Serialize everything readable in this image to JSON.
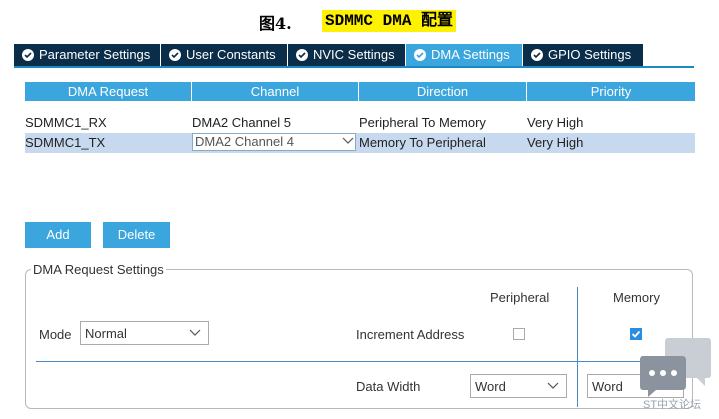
{
  "caption": {
    "number": "图4.",
    "title": "SDMMC DMA 配置"
  },
  "tabs": [
    {
      "label": "Parameter Settings",
      "active": false
    },
    {
      "label": "User Constants",
      "active": false
    },
    {
      "label": "NVIC Settings",
      "active": false
    },
    {
      "label": "DMA Settings",
      "active": true
    },
    {
      "label": "GPIO Settings",
      "active": false
    }
  ],
  "table": {
    "headers": [
      "DMA Request",
      "Channel",
      "Direction",
      "Priority"
    ],
    "rows": [
      {
        "request": "SDMMC1_RX",
        "channel": "DMA2 Channel 5",
        "direction": "Peripheral To Memory",
        "priority": "Very High",
        "selected": false
      },
      {
        "request": "SDMMC1_TX",
        "channel": "DMA2 Channel 4",
        "direction": "Memory To Peripheral",
        "priority": "Very High",
        "selected": true
      }
    ]
  },
  "buttons": {
    "add": "Add",
    "delete": "Delete"
  },
  "settings": {
    "legend": "DMA Request Settings",
    "mode_label": "Mode",
    "mode_value": "Normal",
    "col_peripheral": "Peripheral",
    "col_memory": "Memory",
    "increment_label": "Increment Address",
    "increment_peripheral": false,
    "increment_memory": true,
    "data_width_label": "Data Width",
    "data_width_peripheral": "Word",
    "data_width_memory": "Word"
  },
  "watermark": {
    "text": "ST中文论坛"
  },
  "colors": {
    "tab_dark": "#0a2d4a",
    "tab_active": "#3aa6dd",
    "accent": "#3aa6dd",
    "selected_row": "#c6d9ee",
    "highlight": "#fff200"
  }
}
